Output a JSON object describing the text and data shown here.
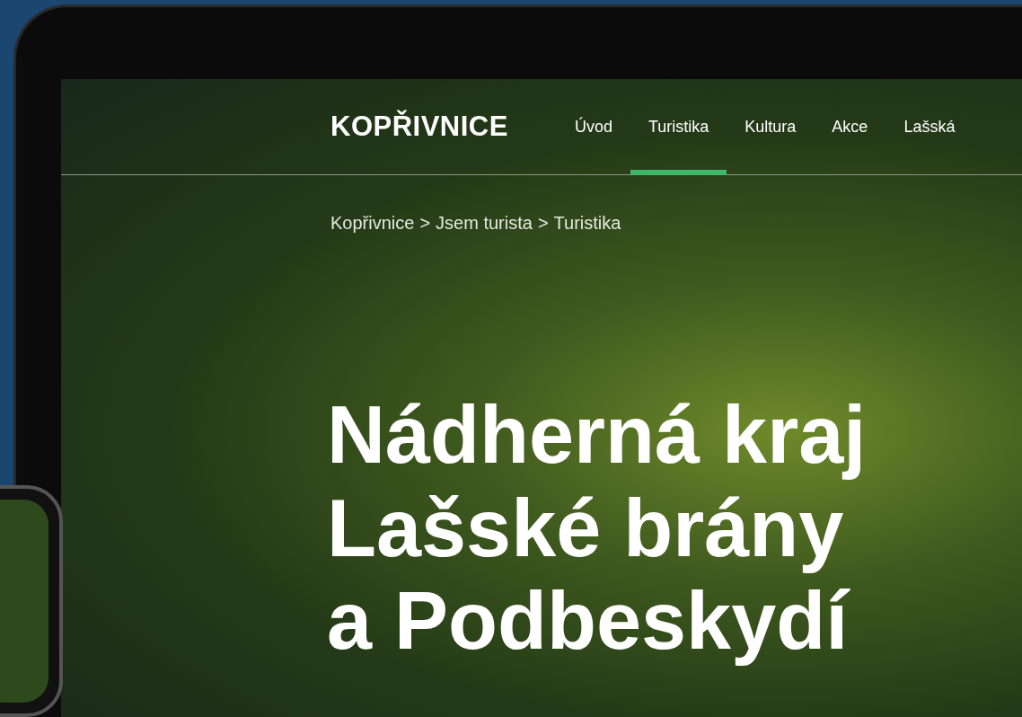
{
  "logo": "KOPŘIVNICE",
  "nav": [
    {
      "label": "Úvod",
      "selected": false
    },
    {
      "label": "Turistika",
      "selected": true
    },
    {
      "label": "Kultura",
      "selected": false
    },
    {
      "label": "Akce",
      "selected": false
    },
    {
      "label": "Lašská",
      "selected": false
    }
  ],
  "breadcrumb": [
    "Kopřivnice",
    "Jsem turista",
    "Turistika"
  ],
  "breadcrumb_separator": ">",
  "headline": [
    "Nádherná kraj",
    "Lašské brány",
    "a Podbeskydí"
  ]
}
